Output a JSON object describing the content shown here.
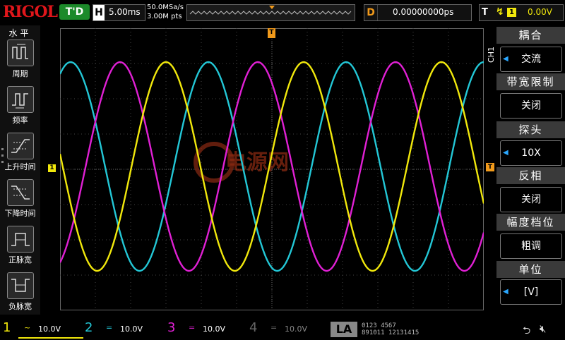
{
  "topbar": {
    "logo": "RIGOL",
    "status": "T'D",
    "horizontal": {
      "label": "H",
      "value": "5.00ms"
    },
    "sample_rate": "50.0MSa/s",
    "memory_depth": "3.00M pts",
    "delay": {
      "label": "D",
      "value": "0.00000000ps"
    },
    "trigger": {
      "label": "T",
      "source": "1",
      "level": "0.00V"
    }
  },
  "left_menu": {
    "title": "水平",
    "items": [
      {
        "label": "周期",
        "icon": "period-icon"
      },
      {
        "label": "频率",
        "icon": "frequency-icon"
      },
      {
        "label": "上升时间",
        "icon": "rise-time-icon"
      },
      {
        "label": "下降时间",
        "icon": "fall-time-icon"
      },
      {
        "label": "正脉宽",
        "icon": "positive-width-icon"
      },
      {
        "label": "负脉宽",
        "icon": "negative-width-icon"
      }
    ]
  },
  "right_menu": {
    "channel_tag": "CH1",
    "items": [
      {
        "title": "耦合",
        "value": "交流",
        "has_arrow": true
      },
      {
        "title": "带宽限制",
        "value": "关闭",
        "has_arrow": false
      },
      {
        "title": "探头",
        "value": "10X",
        "has_arrow": true
      },
      {
        "title": "反相",
        "value": "关闭",
        "has_arrow": false
      },
      {
        "title": "幅度档位",
        "value": "粗调",
        "has_arrow": false
      },
      {
        "title": "单位",
        "value": "[V]",
        "has_arrow": true
      }
    ]
  },
  "watermark": "电源网",
  "markers": {
    "ch1": "1",
    "trigger_pos": "T",
    "trigger_level": "T"
  },
  "bottombar": {
    "channels": [
      {
        "num": "1",
        "coupling": "~",
        "scale": "10.0V",
        "color": "#f1e80c",
        "active": true
      },
      {
        "num": "2",
        "coupling": "=",
        "scale": "10.0V",
        "color": "#23c7d6",
        "active": false
      },
      {
        "num": "3",
        "coupling": "=",
        "scale": "10.0V",
        "color": "#e020d4",
        "active": false
      },
      {
        "num": "4",
        "coupling": "=",
        "scale": "10.0V",
        "color": "#2a55ff",
        "active": false
      }
    ],
    "la": "LA",
    "la_bits_top": "0123 4567",
    "la_bits_bottom": "891011 12131415"
  },
  "colors": {
    "ch1": "#f1e80c",
    "ch2": "#23c7d6",
    "ch3": "#e020d4",
    "trigger": "#f19a1b",
    "run_green": "#1c8a2a"
  }
}
